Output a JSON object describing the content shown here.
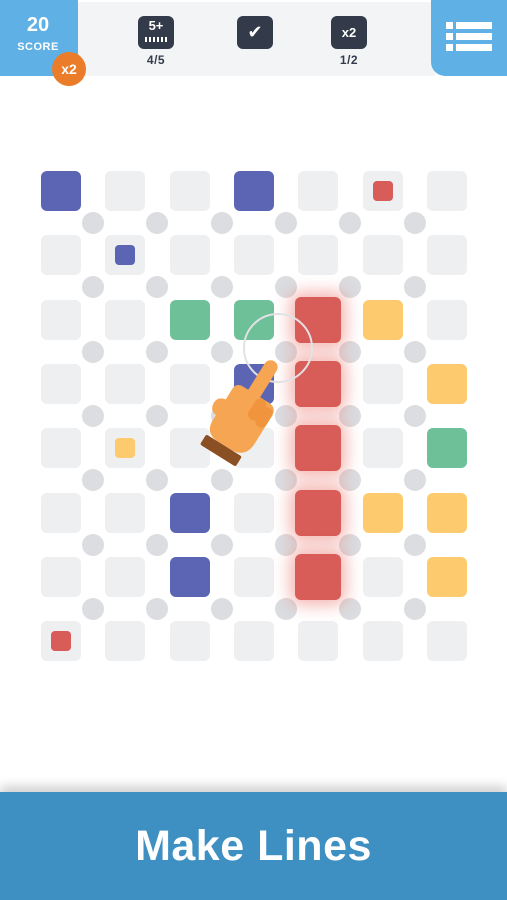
{
  "hud": {
    "score": {
      "value": "20",
      "label": "SCORE",
      "multiplier": "x2"
    },
    "goals": [
      {
        "id": "fiveplus",
        "icon": "five-plus-icon",
        "icon_text": "5+",
        "progress": "4/5"
      },
      {
        "id": "check",
        "icon": "checkmark-icon",
        "icon_text": "✔",
        "progress": ""
      },
      {
        "id": "x2",
        "icon": "x2-multiplier-icon",
        "icon_text": "x2",
        "progress": "1/2"
      }
    ],
    "menu": {
      "icon": "list-menu-icon"
    }
  },
  "colors": {
    "accent_blue": "#5fb0e4",
    "badge_orange": "#ea7c2a",
    "banner_blue": "#3e8fc2",
    "hud_dark": "#333b4a",
    "cell_empty": "#eeeff1",
    "dot": "#dbdde1",
    "tile_colors": {
      "blue": "#5c65b3",
      "green": "#6dc097",
      "red": "#d85c58",
      "yellow": "#fdcb6e"
    }
  },
  "board": {
    "columns": 7,
    "rows": 8,
    "tiles": [
      {
        "row": 0,
        "col": 0,
        "color": "blue",
        "kind": "full"
      },
      {
        "row": 0,
        "col": 3,
        "color": "blue",
        "kind": "full"
      },
      {
        "row": 0,
        "col": 5,
        "color": "red",
        "kind": "small"
      },
      {
        "row": 1,
        "col": 1,
        "color": "blue",
        "kind": "small"
      },
      {
        "row": 2,
        "col": 2,
        "color": "green",
        "kind": "full"
      },
      {
        "row": 2,
        "col": 3,
        "color": "green",
        "kind": "full"
      },
      {
        "row": 2,
        "col": 4,
        "color": "red",
        "kind": "full",
        "highlighted": true
      },
      {
        "row": 2,
        "col": 5,
        "color": "yellow",
        "kind": "full"
      },
      {
        "row": 3,
        "col": 3,
        "color": "blue",
        "kind": "full"
      },
      {
        "row": 3,
        "col": 4,
        "color": "red",
        "kind": "full",
        "highlighted": true
      },
      {
        "row": 3,
        "col": 6,
        "color": "yellow",
        "kind": "full"
      },
      {
        "row": 4,
        "col": 1,
        "color": "yellow",
        "kind": "small"
      },
      {
        "row": 4,
        "col": 4,
        "color": "red",
        "kind": "full",
        "highlighted": true
      },
      {
        "row": 4,
        "col": 6,
        "color": "green",
        "kind": "full"
      },
      {
        "row": 5,
        "col": 2,
        "color": "blue",
        "kind": "full"
      },
      {
        "row": 5,
        "col": 4,
        "color": "red",
        "kind": "full",
        "highlighted": true
      },
      {
        "row": 5,
        "col": 5,
        "color": "yellow",
        "kind": "full"
      },
      {
        "row": 5,
        "col": 6,
        "color": "yellow",
        "kind": "full"
      },
      {
        "row": 6,
        "col": 2,
        "color": "blue",
        "kind": "full"
      },
      {
        "row": 6,
        "col": 4,
        "color": "red",
        "kind": "full",
        "highlighted": true
      },
      {
        "row": 6,
        "col": 6,
        "color": "yellow",
        "kind": "full"
      },
      {
        "row": 7,
        "col": 0,
        "color": "red",
        "kind": "small"
      }
    ],
    "pointer_icon": "pointing-hand-icon"
  },
  "banner": {
    "text": "Make Lines"
  }
}
